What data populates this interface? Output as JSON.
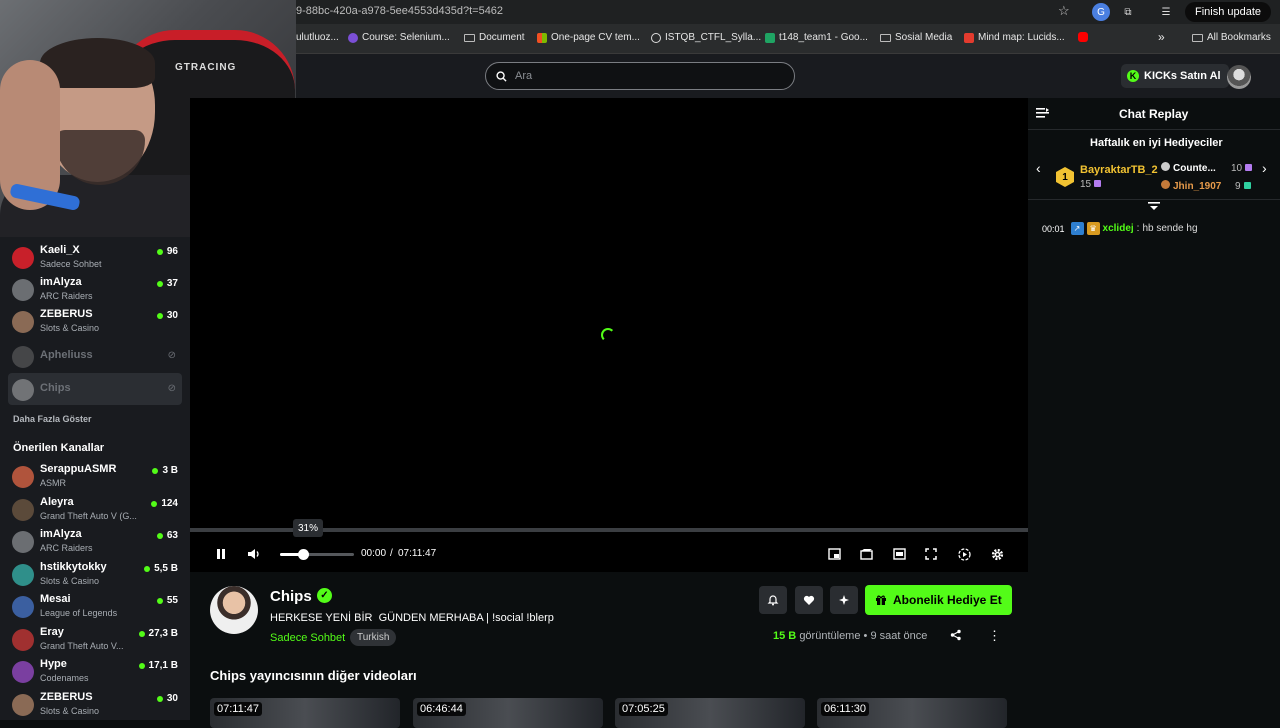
{
  "browser": {
    "url": "9-88bc-420a-a978-5ee4553d435d?t=5462",
    "finish_update": "Finish update",
    "bookmarks": [
      "ulutluoz...",
      "Course: Selenium...",
      "Document",
      "One-page CV tem...",
      "ISTQB_CTFL_Sylla...",
      "t148_team1 - Goo...",
      "Sosial Media",
      "Mind map: Lucids..."
    ],
    "more": "»",
    "all_bookmarks": "All Bookmarks"
  },
  "header": {
    "search_placeholder": "Ara",
    "kicks_label": "KICKs Satın Al",
    "accent": "#53fc18"
  },
  "webcam": {
    "chair_logo": "GTRACING"
  },
  "sidebar": {
    "followed": [
      {
        "name": "Kaeli_X",
        "category": "Sadece Sohbet",
        "viewers": "96",
        "color": "#c8202a"
      },
      {
        "name": "imAlyza",
        "category": "ARC Raiders",
        "viewers": "37",
        "color": "#6b6e72"
      },
      {
        "name": "ZEBERUS",
        "category": "Slots & Casino",
        "viewers": "30",
        "color": "#8a6a55"
      }
    ],
    "offline": [
      {
        "name": "Apheliuss"
      },
      {
        "name": "Chips"
      }
    ],
    "show_more": "Daha Fazla Göster",
    "recommended_title": "Önerilen Kanallar",
    "recommended": [
      {
        "name": "SerappuASMR",
        "category": "ASMR",
        "viewers": "3 B",
        "color": "#b0543c"
      },
      {
        "name": "Aleyra",
        "category": "Grand Theft Auto V (G...",
        "viewers": "124",
        "color": "#5b4a3a"
      },
      {
        "name": "imAlyza",
        "category": "ARC Raiders",
        "viewers": "63",
        "color": "#6b6e72"
      },
      {
        "name": "hstikkytokky",
        "category": "Slots & Casino",
        "viewers": "5,5 B",
        "color": "#2f8f8a"
      },
      {
        "name": "Mesai",
        "category": "League of Legends",
        "viewers": "55",
        "color": "#3b5fa0"
      },
      {
        "name": "Eray",
        "category": "Grand Theft Auto V...",
        "viewers": "27,3 B",
        "color": "#a03030"
      },
      {
        "name": "Hype",
        "category": "Codenames",
        "viewers": "17,1 B",
        "color": "#7a3fa0"
      },
      {
        "name": "ZEBERUS",
        "category": "Slots & Casino",
        "viewers": "30",
        "color": "#8a6a55"
      }
    ]
  },
  "player": {
    "volume_tooltip": "31%",
    "volume_level": 0.31,
    "time_current": "00:00",
    "time_separator": "/",
    "time_total": "07:11:47"
  },
  "channel": {
    "name": "Chips",
    "stream_title": "HERKESE YENİ BİR  GÜNDEN MERHABA | !social !blerp",
    "category": "Sadece Sohbet",
    "language": "Turkish",
    "sub_gift_label": "Abonelik Hediye Et",
    "views_count": "15 B",
    "views_label": "görüntüleme",
    "time_ago": "9 saat önce",
    "other_videos_title": "Chips yayıncısının diğer videoları",
    "videos": [
      "07:11:47",
      "06:46:44",
      "07:05:25",
      "06:11:30"
    ]
  },
  "chat": {
    "title": "Chat Replay",
    "gifters_title": "Haftalık en iyi Hediyeciler",
    "gifters": [
      {
        "rank": "1",
        "name": "BayraktarTB_2",
        "count": "15"
      },
      {
        "name": "Counte...",
        "count": "10"
      },
      {
        "name": "Jhin_1907",
        "count": "9"
      }
    ],
    "messages": [
      {
        "time": "00:01",
        "user": "xclidej",
        "text": "hb sende hg"
      }
    ]
  }
}
